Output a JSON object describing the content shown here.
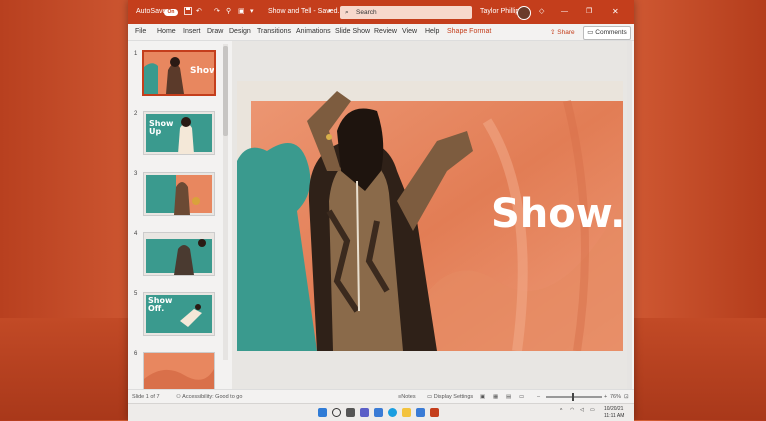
{
  "titlebar": {
    "autosave_label": "AutoSave",
    "autosave_state": "On",
    "doc_title": "Show and Tell - Saved...",
    "search_placeholder": "Search",
    "user_name": "Taylor Phillips"
  },
  "menu": {
    "items": [
      "File",
      "Home",
      "Insert",
      "Draw",
      "Design",
      "Transitions",
      "Animations",
      "Slide Show",
      "Review",
      "View",
      "Help",
      "Shape Format"
    ],
    "share_label": "Share",
    "comments_label": "Comments"
  },
  "thumbnails": {
    "numbers": [
      "1",
      "2",
      "3",
      "4",
      "5",
      "6"
    ],
    "t1": "Show.",
    "t2": "Show Up",
    "t5": "Show Off."
  },
  "slide": {
    "title": "Show."
  },
  "status": {
    "slide_count": "Slide 1 of 7",
    "accessibility": "Accessibility: Good to go",
    "notes": "Notes",
    "display_settings": "Display Settings",
    "zoom": "76%"
  },
  "taskbar": {
    "date": "10/20/21",
    "time": "11:11 AM"
  },
  "colors": {
    "brand": "#c43e1c",
    "teal": "#3a9a8e",
    "coral": "#e8875f"
  }
}
